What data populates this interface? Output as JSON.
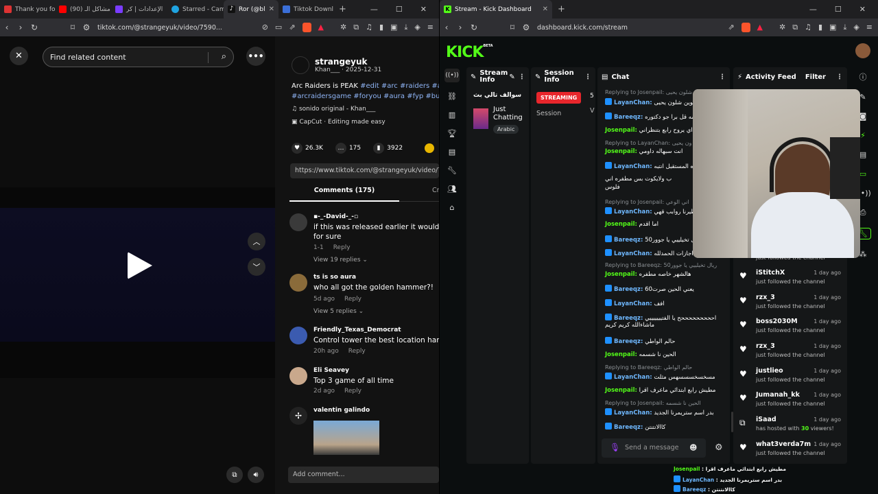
{
  "left_browser": {
    "tabs": [
      "Thank you for",
      "(90) مشاكل الـ",
      "الإعدادات | كر",
      "Starred - Cam",
      "Ror (@bl",
      "Tiktok Downl"
    ],
    "url": "tiktok.com/@strangeyuk/video/7590..."
  },
  "tiktok": {
    "search_placeholder": "Find related content",
    "author": "strangeyuk",
    "author_meta": "Khan___ · 2025-12-31",
    "desc_line1_text": "Arc Raiders is PEAK ",
    "desc_line1_tags": "#edit #arc #raiders #ar",
    "desc_line2_tags": "#arcraidersgame #foryou #aura #fyp #buri",
    "sound": "sonido original - Khan___",
    "capcut": "CapCut · Editing made easy",
    "likes": "26.3K",
    "comments_count": "175",
    "saves": "3922",
    "link": "https://www.tiktok.com/@strangeyuk/video/7590",
    "tab_comments": "Comments (175)",
    "tab_creator": "Cr",
    "comments": [
      {
        "name": "▪-_-David-_-▫",
        "text": "if this was released earlier it would ha",
        "text2": "for sure",
        "date": "1-1",
        "reply": "Reply",
        "replies": "View 19 replies"
      },
      {
        "name": "ts is so aura",
        "text": "who all got the golden hammer?!",
        "date": "5d ago",
        "reply": "Reply",
        "replies": "View 5 replies"
      },
      {
        "name": "Friendly_Texas_Democrat",
        "text": "Control tower the best location hands",
        "date": "20h ago",
        "reply": "Reply"
      },
      {
        "name": "Eli Seavey",
        "text": "Top 3 game of all time",
        "date": "2d ago",
        "reply": "Reply"
      },
      {
        "name": "valentin galindo"
      }
    ],
    "add_comment": "Add comment..."
  },
  "right_browser": {
    "tab": "Stream - Kick Dashboard",
    "url": "dashboard.kick.com/stream"
  },
  "kick": {
    "logo": "KICK",
    "beta": "BETA",
    "stream_info": "Stream Info",
    "session_info": "Session Info",
    "chat": "Chat",
    "activity": "Activity Feed",
    "filter": "Filter",
    "stream_title": "سوالف تالي بث",
    "category": "Just Chatting",
    "language": "Arabic",
    "streaming": "STREAMING",
    "session": "Session",
    "s_num": "5",
    "s_v": "V",
    "chat_lines": [
      {
        "reply": "Replying to Josenpail: وإمه شلون يحيى"
      },
      {
        "user": "LayanChan:",
        "msg": "داوموين شلون يحيى",
        "badge": true
      },
      {
        "user": "Bareeqz:",
        "msg": "درسه قل برا جو دكتوره",
        "badge": true
      },
      {
        "user": "Josenpail:",
        "msg": "اي يروح رابع بتنظراني"
      },
      {
        "reply": "Replying to LayanChan: ون يحيى"
      },
      {
        "user": "Josenpail:",
        "msg": "انت سبهاله داومي"
      },
      {
        "user": "LayanChan:",
        "msg": "دكتوره المستقبل انتبه",
        "badge": true
      },
      {
        "user": "",
        "msg": "ب ولايكوت بس مطفره اني"
      },
      {
        "user": "",
        "msg": "فلوس"
      },
      {
        "reply": "Replying to Josenpail: اني الوعي"
      },
      {
        "user": "LayanChan:",
        "msg": "وطيرنا روابب قهي",
        "badge": true
      },
      {
        "user": "Josenpail:",
        "msg": "اما اقدم"
      },
      {
        "user": "Bareeqz:",
        "msg": "50ريال تخيلييي يا جوور",
        "badge": true
      },
      {
        "user": "LayanChan:",
        "msg": "وعندنا اجازات الحمدلله",
        "badge": true
      },
      {
        "reply": "Replying to Bareeqz: 50ريال تخيلييي يا جوور"
      },
      {
        "user": "Josenpail:",
        "msg": "هالشهر خاصه مطفره"
      },
      {
        "user": "Bareeqz:",
        "msg": "يعني الحين صرت60",
        "badge": true
      },
      {
        "user": "LayanChan:",
        "msg": "افف",
        "badge": true
      },
      {
        "user": "Bareeqz:",
        "msg": "احححححححححح يا الفتيييييييي",
        "badge": true
      },
      {
        "user": "",
        "msg": "ماشاءالله كريم كريم"
      },
      {
        "user": "Bareeqz:",
        "msg": "حالم الواطي",
        "badge": true
      },
      {
        "user": "Josenpail:",
        "msg": "الحين نا شسمه"
      },
      {
        "reply": "Replying to Bareeqz: حالم الواطي"
      },
      {
        "user": "LayanChan:",
        "msg": "مسخسخسسسهس مثلت",
        "badge": true
      },
      {
        "user": "Josenpail:",
        "msg": "مطيش رابع ابتدائي ماعرف اقرا"
      },
      {
        "reply": "Replying to Josenpail: الحين نا شسمه"
      },
      {
        "user": "LayanChan:",
        "msg": "بدر اسم ستريمرنا الجديد",
        "badge": true
      },
      {
        "user": "Bareeqz:",
        "msg": "كاالانتنتن",
        "badge": true
      }
    ],
    "chat_placeholder": "Send a message",
    "feed": [
      {
        "name": "iStitchX",
        "text": "just followed the channel",
        "date": "1 day ago"
      },
      {
        "name": "rzx_3",
        "text": "just followed the channel",
        "date": "1 day ago"
      },
      {
        "name": "boss2030M",
        "text": "just followed the channel",
        "date": "1 day ago"
      },
      {
        "name": "rzx_3",
        "text": "just followed the channel",
        "date": "1 day ago"
      },
      {
        "name": "justlieo",
        "text": "just followed the channel",
        "date": "1 day ago"
      },
      {
        "name": "Jumanah_kk",
        "text": "just followed the channel",
        "date": "1 day ago"
      },
      {
        "name": "iSaad",
        "text": "has hosted with ",
        "num": "30",
        "text2": " viewers!",
        "date": "1 day ago"
      },
      {
        "name": "what3verda7m",
        "text": "just followed the channel",
        "date": "1 day ago"
      }
    ],
    "feed_top_partial": "just followed the channel",
    "overlay_chat": [
      {
        "user": "Josenpail",
        "msg": " : مطيش رابع ابتدائي ماعرف اقرا"
      },
      {
        "user": "LayanChan",
        "msg": " : بدر اسم ستريمرنا الجديد"
      },
      {
        "user": "Bareeqz",
        "msg": " : كاالانتنتن"
      }
    ]
  }
}
